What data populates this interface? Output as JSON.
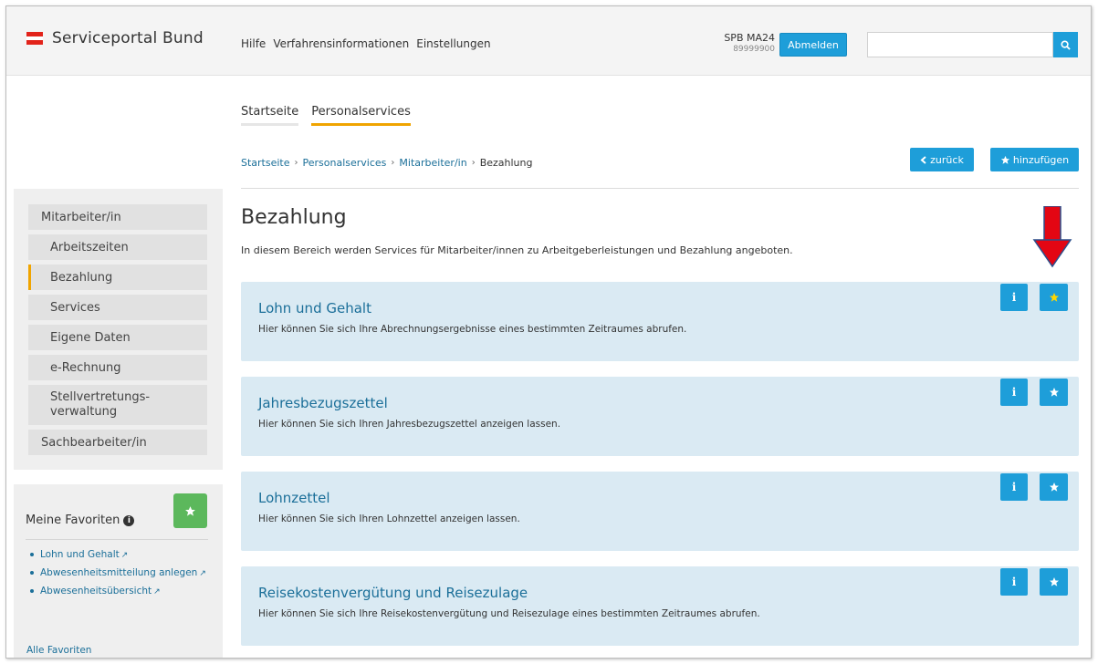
{
  "header": {
    "logo_text": "Serviceportal Bund",
    "nav": [
      "Hilfe",
      "Verfahrensinformationen",
      "Einstellungen"
    ],
    "user_name": "SPB MA24",
    "user_number": "89999900",
    "logout_label": "Abmelden",
    "search_placeholder": ""
  },
  "tabs": [
    {
      "label": "Startseite",
      "active": false
    },
    {
      "label": "Personalservices",
      "active": true
    }
  ],
  "breadcrumb": [
    "Startseite",
    "Personalservices",
    "Mitarbeiter/in",
    "Bezahlung"
  ],
  "actions": {
    "back_label": "zurück",
    "add_label": "hinzufügen"
  },
  "sidebar": {
    "items": [
      {
        "label": "Mitarbeiter/in"
      },
      {
        "label": "Arbeitszeiten"
      },
      {
        "label": "Bezahlung"
      },
      {
        "label": "Services"
      },
      {
        "label": "Eigene Daten"
      },
      {
        "label": "e-Rechnung"
      },
      {
        "label": "Stellvertretungs-",
        "label2": "verwaltung"
      },
      {
        "label": "Sachbearbeiter/in"
      }
    ]
  },
  "favorites": {
    "title": "Meine Favoriten",
    "items": [
      "Lohn und Gehalt",
      "Abwesenheitsmitteilung anlegen",
      "Abwesenheitsübersicht"
    ],
    "all_label": "Alle Favoriten"
  },
  "main": {
    "title": "Bezahlung",
    "description": "In diesem Bereich werden Services für Mitarbeiter/innen zu Arbeitgeberleistungen und Bezahlung angeboten.",
    "cards": [
      {
        "title": "Lohn und Gehalt",
        "description": "Hier können Sie sich Ihre Abrechnungsergebnisse eines bestimmten Zeitraumes abrufen.",
        "favorited": true
      },
      {
        "title": "Jahresbezugszettel",
        "description": "Hier können Sie sich Ihren Jahresbezugszettel anzeigen lassen.",
        "favorited": false
      },
      {
        "title": "Lohnzettel",
        "description": "Hier können Sie sich Ihren Lohnzettel anzeigen lassen.",
        "favorited": false
      },
      {
        "title": "Reisekostenvergütung und Reisezulage",
        "description": "Hier können Sie sich Ihre Reisekostenvergütung und Reisezulage eines bestimmten Zeitraumes abrufen.",
        "favorited": false
      }
    ],
    "info_glyph": "i"
  },
  "colors": {
    "accent": "#1e9ed9",
    "active_tab": "#f0a400",
    "card_bg": "#daeaf3",
    "favorite_star": "#ffd700",
    "arrow": "#e30613"
  }
}
